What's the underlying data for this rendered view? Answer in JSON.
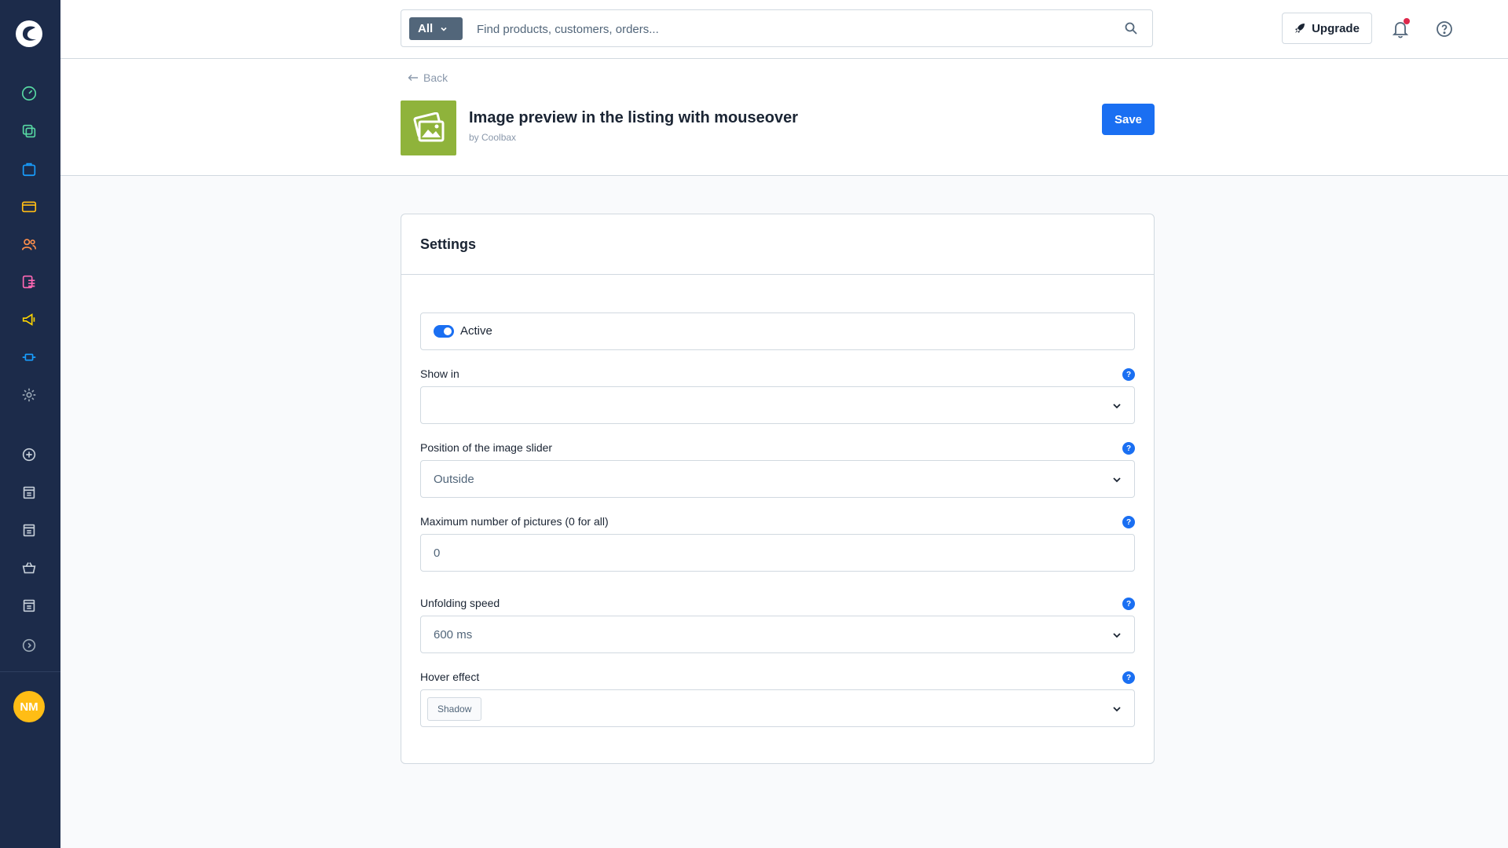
{
  "sidebar": {
    "items": [
      {
        "icon": "dashboard-icon",
        "color": "#57d9a3"
      },
      {
        "icon": "catalogues-icon",
        "color": "#57d9a3"
      },
      {
        "icon": "orders-icon",
        "color": "#189eff"
      },
      {
        "icon": "payment-card-icon",
        "color": "#ffbd15"
      },
      {
        "icon": "customers-icon",
        "color": "#ff8f4a"
      },
      {
        "icon": "content-icon",
        "color": "#ff68b4"
      },
      {
        "icon": "marketing-icon",
        "color": "#ffd700"
      },
      {
        "icon": "extensions-icon",
        "color": "#189eff"
      },
      {
        "icon": "settings-icon",
        "color": "#9aa8b5"
      }
    ],
    "sales_channels": [
      {
        "icon": "add-circle-icon"
      },
      {
        "icon": "storefront-icon"
      },
      {
        "icon": "storefront-icon"
      },
      {
        "icon": "basket-icon"
      },
      {
        "icon": "storefront-icon"
      }
    ],
    "collapse_icon": "chevron-right-circle-icon",
    "avatar_initials": "NM"
  },
  "topbar": {
    "search_scope": "All",
    "search_placeholder": "Find products, customers, orders...",
    "upgrade_label": "Upgrade"
  },
  "header": {
    "back_label": "Back",
    "app_title": "Image preview in the listing with mouseover",
    "app_by": "by Coolbax",
    "save_label": "Save",
    "app_icon_color": "#8fb33b"
  },
  "settings": {
    "title": "Settings",
    "active_label": "Active",
    "fields": {
      "show_in": {
        "label": "Show in",
        "value": ""
      },
      "slider_position": {
        "label": "Position of the image slider",
        "value": "Outside"
      },
      "max_pictures": {
        "label": "Maximum number of pictures (0 for all)",
        "value": "0"
      },
      "unfolding_speed": {
        "label": "Unfolding speed",
        "value": "600 ms"
      },
      "hover_effect": {
        "label": "Hover effect",
        "value": "Shadow"
      }
    },
    "help_glyph": "?"
  }
}
